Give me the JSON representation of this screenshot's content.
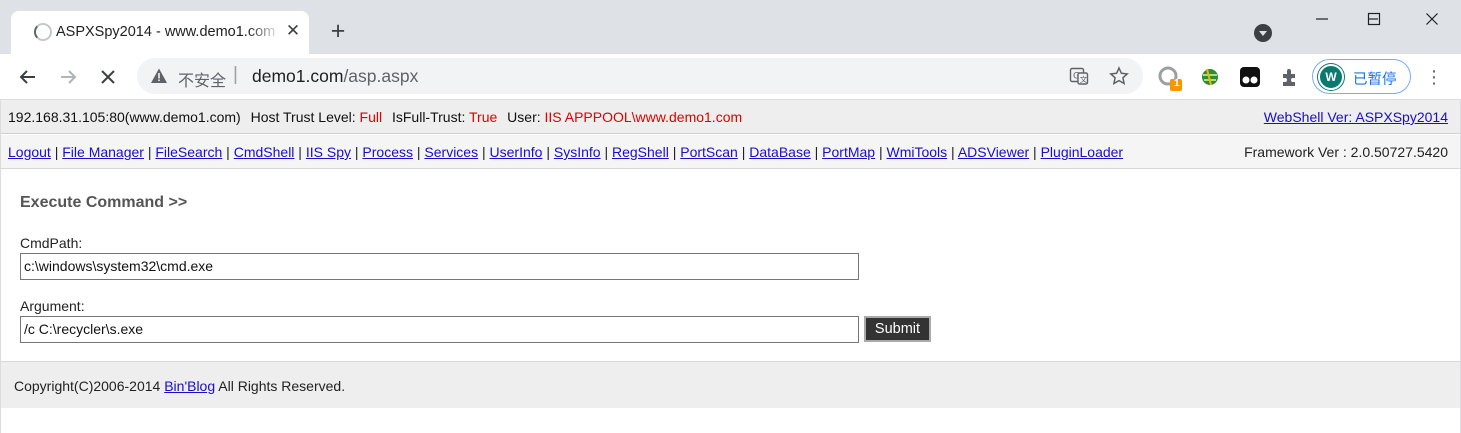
{
  "browser": {
    "tab_title": "ASPXSpy2014 - www.demo1.com",
    "insecure_label": "不安全",
    "url_host": "demo1.com",
    "url_path": "/asp.aspx",
    "profile_initial": "W",
    "profile_label": "已暂停",
    "extension_badge": "1"
  },
  "info_bar": {
    "host": "192.168.31.105:80(www.demo1.com)",
    "trust_label": "Host Trust Level:",
    "trust_value": "Full",
    "fulltrust_label": "IsFull-Trust:",
    "fulltrust_value": "True",
    "user_label": "User:",
    "user_value": "IIS APPPOOL\\www.demo1.com",
    "version_link": "WebShell Ver: ASPXSpy2014"
  },
  "nav": {
    "items": [
      "Logout",
      "File Manager",
      "FileSearch",
      "CmdShell",
      "IIS Spy",
      "Process",
      "Services",
      "UserInfo",
      "SysInfo",
      "RegShell",
      "PortScan",
      "DataBase",
      "PortMap",
      "WmiTools",
      "ADSViewer",
      "PluginLoader"
    ],
    "framework": "Framework Ver : 2.0.50727.5420"
  },
  "main": {
    "heading": "Execute Command >>",
    "cmdpath_label": "CmdPath:",
    "cmdpath_value": "c:\\windows\\system32\\cmd.exe",
    "argument_label": "Argument:",
    "argument_value": "/c C:\\recycler\\s.exe",
    "submit_label": "Submit"
  },
  "footer": {
    "prefix": "Copyright(C)2006-2014",
    "link": "Bin'Blog",
    "suffix": "All Rights Reserved."
  }
}
